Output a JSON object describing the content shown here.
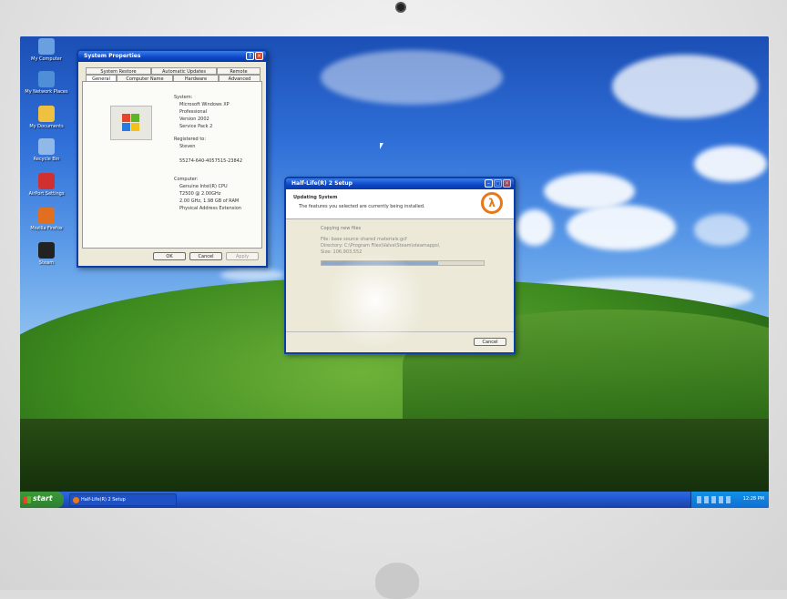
{
  "desktop": {
    "icons": [
      {
        "label": "My Computer",
        "icon": "computer-icon",
        "color": "#6aa0e0"
      },
      {
        "label": "My Network Places",
        "icon": "network-icon",
        "color": "#4f8fd8"
      },
      {
        "label": "My Documents",
        "icon": "folder-icon",
        "color": "#f0c040"
      },
      {
        "label": "Recycle Bin",
        "icon": "recycle-bin-icon",
        "color": "#90b8e8"
      },
      {
        "label": "AirPort Settings",
        "icon": "airport-icon",
        "color": "#d03030"
      },
      {
        "label": "Mozilla Firefox",
        "icon": "firefox-icon",
        "color": "#e07020"
      },
      {
        "label": "Steam",
        "icon": "steam-icon",
        "color": "#222222"
      }
    ]
  },
  "system_properties": {
    "title": "System Properties",
    "tabs_row1": [
      "System Restore",
      "Automatic Updates",
      "Remote"
    ],
    "tabs_row2": [
      "General",
      "Computer Name",
      "Hardware",
      "Advanced"
    ],
    "system_heading": "System:",
    "system_lines": [
      "Microsoft Windows XP",
      "Professional",
      "Version 2002",
      "Service Pack 2"
    ],
    "registered_heading": "Registered to:",
    "registered_lines": [
      "Steven",
      "",
      "55274-640-4057515-23842"
    ],
    "computer_heading": "Computer:",
    "computer_lines": [
      "Genuine Intel(R) CPU",
      "T2500  @ 2.00GHz",
      "2.00 GHz, 1.98 GB of RAM",
      "Physical Address Extension"
    ],
    "ok": "OK",
    "cancel": "Cancel",
    "apply": "Apply",
    "help_icon": "help-icon",
    "close_icon": "close-icon"
  },
  "setup": {
    "title": "Half-Life(R) 2 Setup",
    "header_title": "Updating System",
    "header_sub": "The features you selected are currently being installed.",
    "status": "Copying new files",
    "file": "File: base source shared materials.gcf",
    "directory": "Directory: C:\\Program Files\\Valve\\Steam\\steamapps\\",
    "size": "Size: 106,903,552",
    "progress": 0.72,
    "cancel": "Cancel",
    "logo_icon": "half-life-lambda-icon"
  },
  "taskbar": {
    "start": "start",
    "task": "Half-Life(R) 2 Setup",
    "clock": "12:28 PM"
  }
}
